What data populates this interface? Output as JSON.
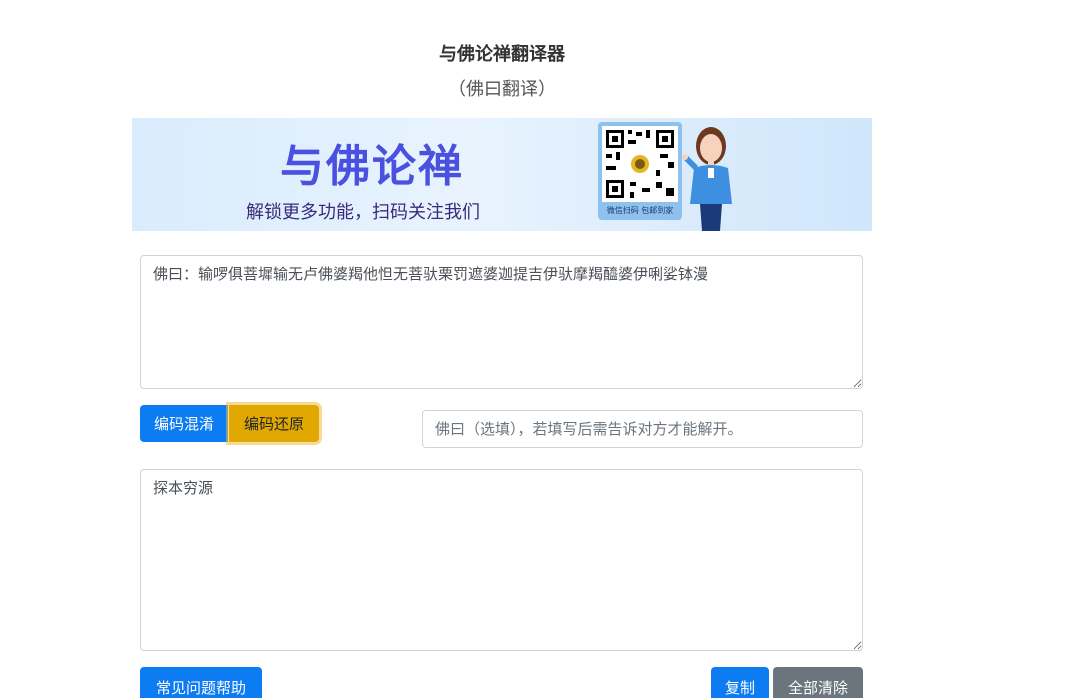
{
  "header": {
    "title": "与佛论禅翻译器",
    "subtitle": "（佛曰翻译）"
  },
  "banner": {
    "headline": "与佛论禅",
    "tagline": "解锁更多功能，扫码关注我们",
    "qr_caption": "微信扫码 包邮到家"
  },
  "editor": {
    "input_text": "佛曰：输啰俱菩墀输无卢佛婆羯他怛无菩驮栗罚遮婆迦提吉伊驮摩羯醯婆伊唎娑钵漫",
    "output_text": "探本穷源"
  },
  "actions": {
    "encode_label": "编码混淆",
    "decode_label": "编码还原",
    "key_placeholder": "佛曰（选填），若填写后需告诉对方才能解开。",
    "help_label": "常见问题帮助",
    "copy_label": "复制",
    "clear_label": "全部清除"
  },
  "colors": {
    "primary": "#0d7cf2",
    "warning": "#e0a800",
    "secondary": "#6c757d",
    "banner_headline": "#4a50e0"
  }
}
